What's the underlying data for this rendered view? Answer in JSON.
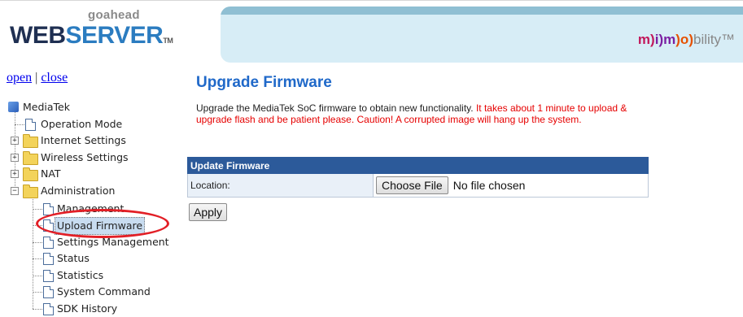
{
  "header": {
    "brand_top": "goahead",
    "brand_main_a": "WEB",
    "brand_main_b": "SERVER",
    "brand_tm": "TM",
    "banner_logo": {
      "m1": "m",
      "p1": ")",
      "i": "i",
      "p2": ")",
      "m2": "m",
      "p3": ")",
      "o": "o",
      "p4": ")",
      "rest": "bility",
      "tm": "™"
    }
  },
  "tree": {
    "open_label": "open",
    "separator": " | ",
    "close_label": "close",
    "root": "MediaTek",
    "items": [
      {
        "label": "Operation Mode",
        "type": "page"
      },
      {
        "label": "Internet Settings",
        "type": "folder",
        "expanded": false
      },
      {
        "label": "Wireless Settings",
        "type": "folder",
        "expanded": false
      },
      {
        "label": "NAT",
        "type": "folder",
        "expanded": false
      },
      {
        "label": "Administration",
        "type": "folder",
        "expanded": true
      }
    ],
    "admin_children": [
      {
        "label": "Management"
      },
      {
        "label": "Upload Firmware",
        "selected": true
      },
      {
        "label": "Settings Management"
      },
      {
        "label": "Status"
      },
      {
        "label": "Statistics"
      },
      {
        "label": "System Command"
      },
      {
        "label": "SDK History"
      }
    ],
    "highlight_color": "#e21f26"
  },
  "main": {
    "title": "Upgrade Firmware",
    "desc_normal": "Upgrade the MediaTek SoC firmware to obtain new functionality.",
    "desc_warning": " It takes about 1 minute to upload & upgrade flash and be patient please. Caution! A corrupted image will hang up the system.",
    "table": {
      "header": "Update Firmware",
      "location_label": "Location:",
      "choose_file": "Choose File",
      "no_file": "No file chosen"
    },
    "apply": "Apply"
  },
  "colors": {
    "title": "#2069c9",
    "table_header": "#2c5a9a",
    "warning": "#e60000"
  }
}
